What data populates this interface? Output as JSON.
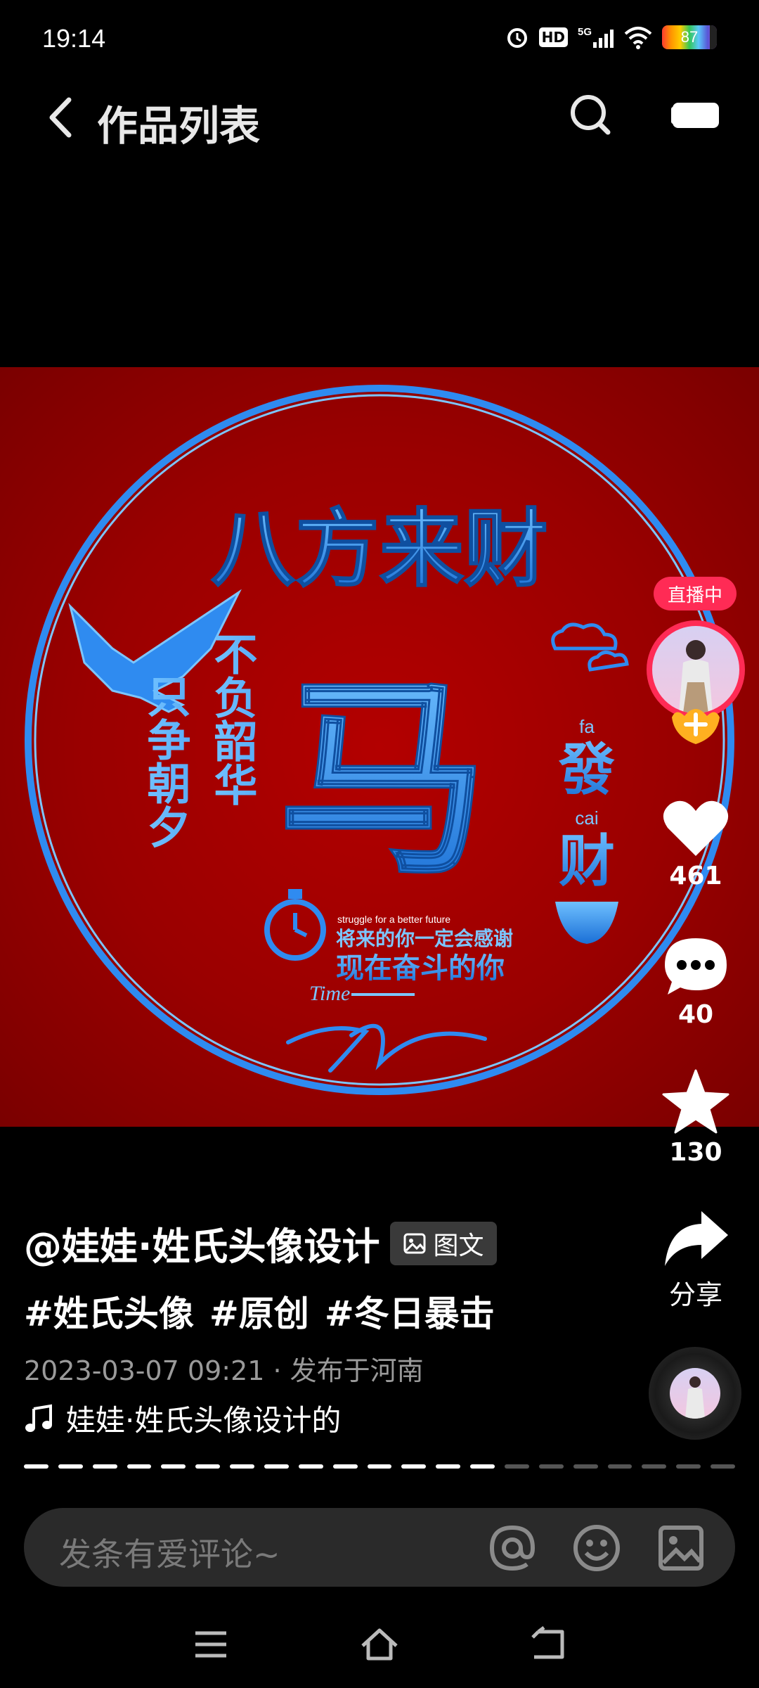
{
  "status": {
    "time": "19:14",
    "network": "5G",
    "hd": "HD",
    "battery": "87",
    "battery_level": 0.87
  },
  "header": {
    "title": "作品列表",
    "icons": [
      "back-icon",
      "search-icon",
      "camera-icon"
    ]
  },
  "artwork": {
    "main_title": "八方来财",
    "center_char": "马",
    "left_text_1": "不负韶华",
    "left_text_2": "只争朝夕",
    "right_pinyin_1": "fa",
    "right_char_1": "發",
    "right_pinyin_2": "cai",
    "right_char_2": "财",
    "small_en": "struggle for a better future",
    "slogan_1": "将来的你一定会感谢",
    "slogan_2": "现在奋斗的你",
    "time_label": "Time",
    "colors": {
      "background": "#9a0000",
      "accent": "#2f8bf0"
    }
  },
  "side": {
    "live_badge": "直播中",
    "likes": "461",
    "comments": "40",
    "favorites": "130",
    "share_label": "分享"
  },
  "post": {
    "author": "@娃娃·姓氏头像设计",
    "type_chip": "图文",
    "hashtags": [
      "#姓氏头像",
      "#原创",
      "#冬日暴击"
    ],
    "meta": "2023-03-07 09:21 · 发布于河南",
    "music": "娃娃·姓氏头像设计的"
  },
  "progress": {
    "total": 21,
    "current": 14
  },
  "comment": {
    "placeholder": "发条有爱评论~"
  },
  "nav": {
    "icons": [
      "menu-icon",
      "home-icon",
      "back-nav-icon"
    ]
  }
}
